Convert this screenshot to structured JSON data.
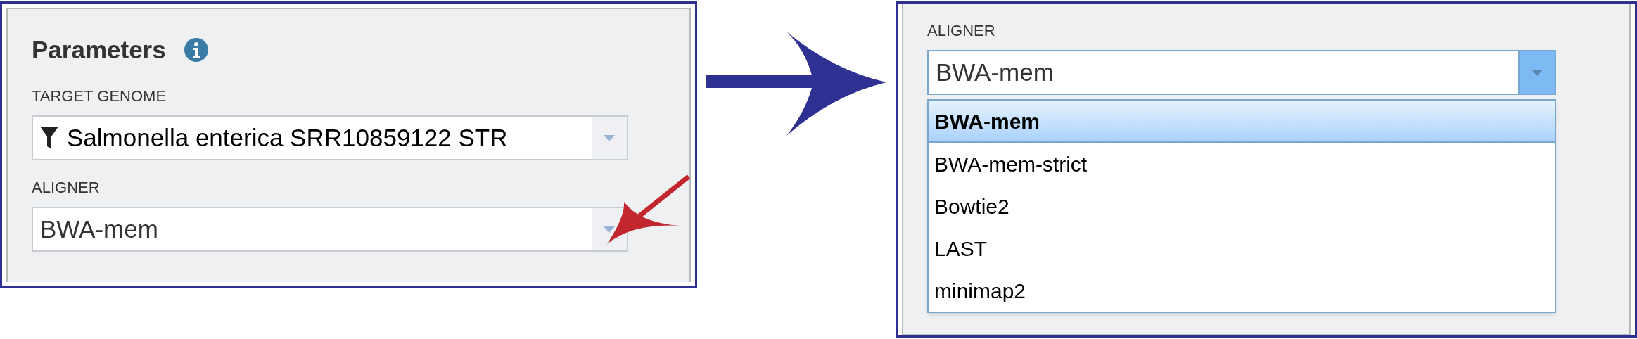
{
  "left_panel": {
    "title": "Parameters",
    "fields": [
      {
        "kind": "filter-select",
        "label": "TARGET GENOME",
        "value": "Salmonella enterica SRR10859122 STR",
        "expanded": false
      },
      {
        "kind": "select",
        "label": "ALIGNER",
        "value": "BWA-mem",
        "expanded": false
      }
    ]
  },
  "right_panel": {
    "fields": [
      {
        "kind": "select",
        "label": "ALIGNER",
        "value": "BWA-mem",
        "expanded": true,
        "options": [
          {
            "label": "BWA-mem",
            "selected": true
          },
          {
            "label": "BWA-mem-strict",
            "selected": false
          },
          {
            "label": "Bowtie2",
            "selected": false
          },
          {
            "label": "LAST",
            "selected": false
          },
          {
            "label": "minimap2",
            "selected": false
          }
        ]
      }
    ]
  }
}
